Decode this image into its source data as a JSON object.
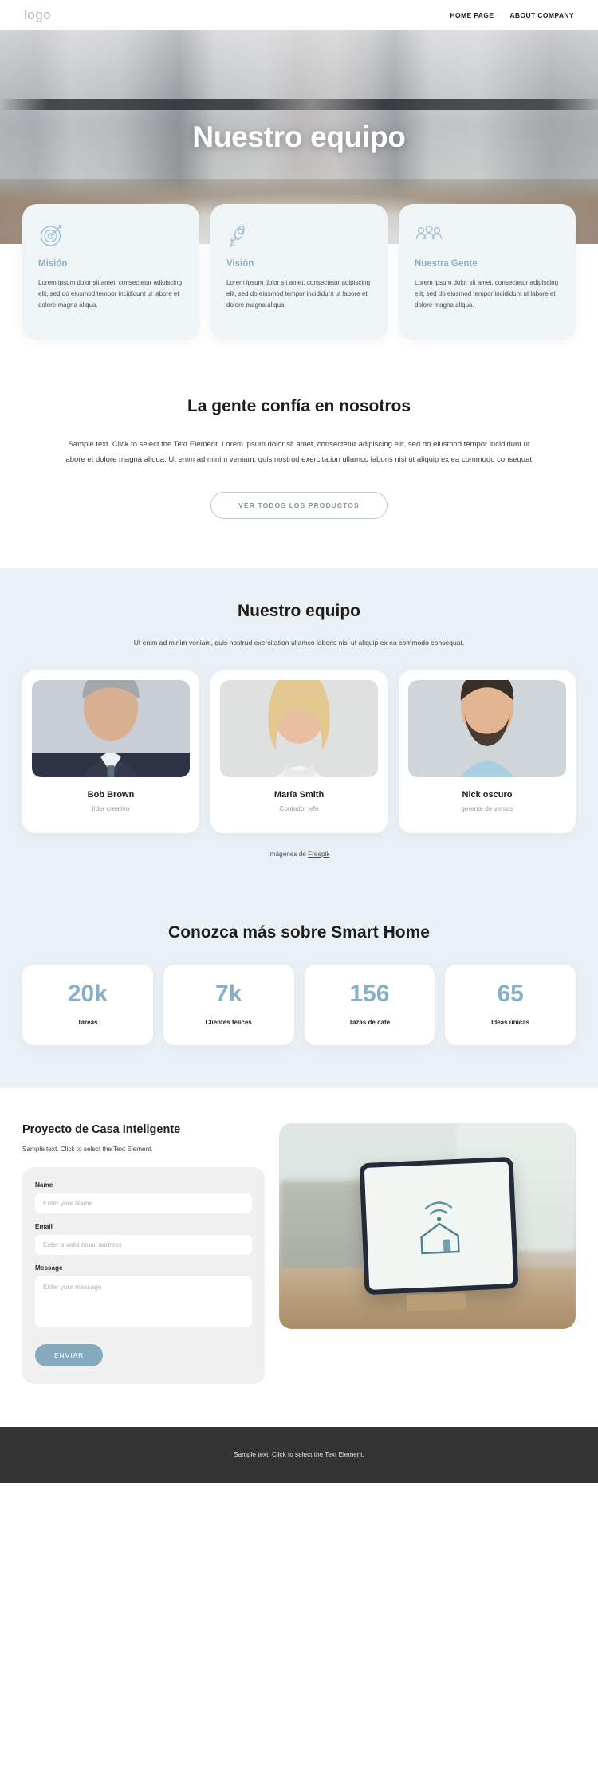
{
  "header": {
    "logo": "logo",
    "nav": [
      {
        "label": "HOME PAGE"
      },
      {
        "label": "ABOUT COMPANY"
      }
    ]
  },
  "hero": {
    "title": "Nuestro equipo"
  },
  "features": [
    {
      "icon": "target-icon",
      "title": "Misión",
      "text": "Lorem ipsum dolor sit amet, consectetur adipiscing elit, sed do eiusmod tempor incididunt ut labore et dolore magna aliqua."
    },
    {
      "icon": "rocket-icon",
      "title": "Visión",
      "text": "Lorem ipsum dolor sit amet, consectetur adipiscing elit, sed do eiusmod tempor incididunt ut labore et dolore magna aliqua."
    },
    {
      "icon": "people-group-icon",
      "title": "Nuestra Gente",
      "text": "Lorem ipsum dolor sit amet, consectetur adipiscing elit, sed do eiusmod tempor incididunt ut labore et dolore magna aliqua."
    }
  ],
  "trust": {
    "title": "La gente confía en nosotros",
    "text": "Sample text. Click to select the Text Element. Lorem ipsum dolor sit amet, consectetur adipiscing elit, sed do eiusmod tempor incididunt ut labore et dolore magna aliqua. Ut enim ad minim veniam, quis nostrud exercitation ullamco laboris nisi ut aliquip ex ea commodo consequat.",
    "button": "VER TODOS LOS PRODUCTOS"
  },
  "team": {
    "title": "Nuestro equipo",
    "subtitle": "Ut enim ad minim veniam, quis nostrud exercitation ullamco laboris nisi ut aliquip ex ea commodo consequat.",
    "members": [
      {
        "name": "Bob Brown",
        "role": "líder creativo"
      },
      {
        "name": "María Smith",
        "role": "Contador jefe"
      },
      {
        "name": "Nick oscuro",
        "role": "gerente de ventas"
      }
    ],
    "credit_prefix": "Imágenes de ",
    "credit_link": "Freepik"
  },
  "stats": {
    "title": "Conozca más sobre Smart Home",
    "items": [
      {
        "value": "20k",
        "label": "Tareas"
      },
      {
        "value": "7k",
        "label": "Clientes felices"
      },
      {
        "value": "156",
        "label": "Tazas de café"
      },
      {
        "value": "65",
        "label": "Ideas únicas"
      }
    ]
  },
  "contact": {
    "title": "Proyecto de Casa Inteligente",
    "subtitle": "Sample text. Click to select the Text Element.",
    "fields": {
      "name_label": "Name",
      "name_placeholder": "Enter your Name",
      "email_label": "Email",
      "email_placeholder": "Enter a valid email address",
      "message_label": "Message",
      "message_placeholder": "Enter your message"
    },
    "submit_label": "ENVIAR"
  },
  "footer": {
    "text": "Sample text. Click to select the Text Element."
  },
  "colors": {
    "accent": "#86b0c6",
    "section_bg": "#eaf1f6",
    "card_bg": "#eff4f7",
    "button": "#86aabd",
    "footer_bg": "#333333"
  }
}
